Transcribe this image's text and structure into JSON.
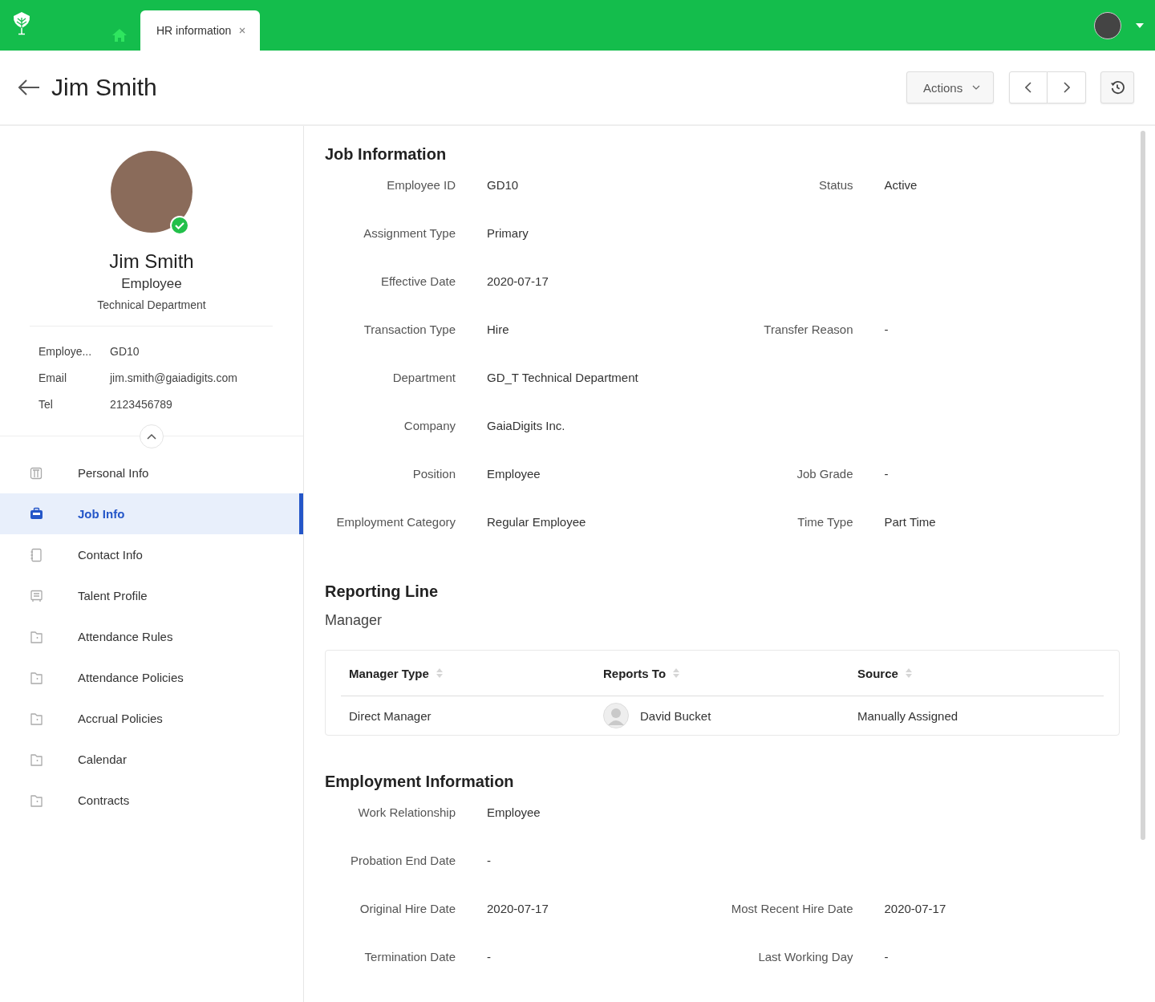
{
  "topbar": {
    "tabs": [
      {
        "label": "HR information",
        "selected": true
      }
    ]
  },
  "header": {
    "title": "Jim Smith",
    "actions_button": "Actions"
  },
  "profile": {
    "name": "Jim Smith",
    "role": "Employee",
    "department": "Technical Department",
    "verified": true,
    "details": [
      {
        "label": "Employe...",
        "value": "GD10"
      },
      {
        "label": "Email",
        "value": "jim.smith@gaiadigits.com"
      },
      {
        "label": "Tel",
        "value": "2123456789"
      }
    ]
  },
  "nav": [
    {
      "label": "Personal Info",
      "kind": "personal",
      "selected": false
    },
    {
      "label": "Job Info",
      "kind": "job",
      "selected": true
    },
    {
      "label": "Contact Info",
      "kind": "contact",
      "selected": false
    },
    {
      "label": "Talent Profile",
      "kind": "talent",
      "selected": false
    },
    {
      "label": "Attendance Rules",
      "kind": "folder",
      "selected": false
    },
    {
      "label": "Attendance Policies",
      "kind": "folder",
      "selected": false
    },
    {
      "label": "Accrual Policies",
      "kind": "folder",
      "selected": false
    },
    {
      "label": "Calendar",
      "kind": "folder",
      "selected": false
    },
    {
      "label": "Contracts",
      "kind": "folder",
      "selected": false
    }
  ],
  "sections": [
    {
      "kind": "fields",
      "title": "Job Information",
      "rows": [
        [
          {
            "label": "Employee ID",
            "value": "GD10"
          },
          {
            "label": "Status",
            "value": "Active"
          }
        ],
        [
          {
            "label": "Assignment Type",
            "value": "Primary"
          }
        ],
        [
          {
            "label": "Effective Date",
            "value": "2020-07-17"
          }
        ],
        [
          {
            "label": "Transaction Type",
            "value": "Hire"
          },
          {
            "label": "Transfer Reason",
            "value": "-"
          }
        ],
        [
          {
            "label": "Department",
            "value": "GD_T Technical Department"
          }
        ],
        [
          {
            "label": "Company",
            "value": "GaiaDigits Inc."
          }
        ],
        [
          {
            "label": "Position",
            "value": "Employee"
          },
          {
            "label": "Job Grade",
            "value": "-"
          }
        ],
        [
          {
            "label": "Employment Category",
            "value": "Regular Employee"
          },
          {
            "label": "Time Type",
            "value": "Part Time"
          }
        ]
      ]
    },
    {
      "kind": "table",
      "title": "Reporting Line",
      "subtitle": "Manager",
      "columns": [
        "Manager Type",
        "Reports To",
        "Source"
      ],
      "rows": [
        [
          "Direct Manager",
          "David Bucket",
          "Manually Assigned"
        ]
      ]
    },
    {
      "kind": "fields",
      "title": "Employment Information",
      "rows": [
        [
          {
            "label": "Work Relationship",
            "value": "Employee"
          }
        ],
        [
          {
            "label": "Probation End Date",
            "value": "-"
          }
        ],
        [
          {
            "label": "Original Hire Date",
            "value": "2020-07-17"
          },
          {
            "label": "Most Recent Hire Date",
            "value": "2020-07-17"
          }
        ],
        [
          {
            "label": "Termination Date",
            "value": "-"
          },
          {
            "label": "Last Working Day",
            "value": "-"
          }
        ]
      ]
    }
  ]
}
